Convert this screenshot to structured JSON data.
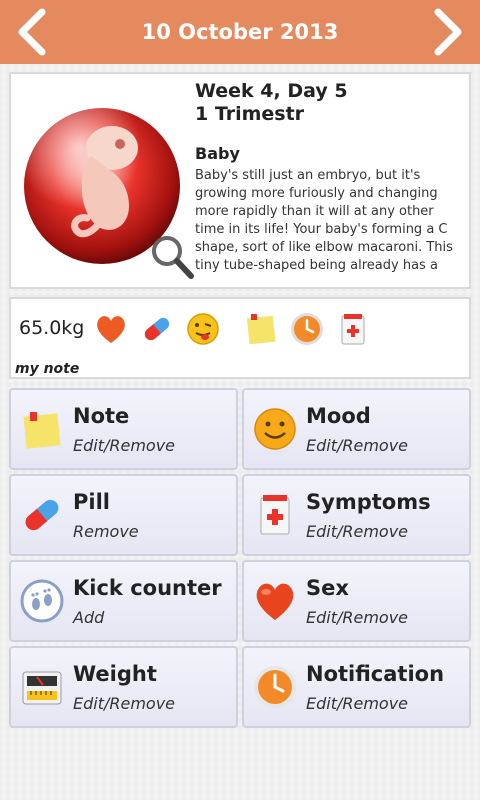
{
  "header": {
    "title": "10 October 2013"
  },
  "info": {
    "week": "Week 4, Day 5",
    "trimester": "1 Trimestr",
    "section_title": "Baby",
    "description": "Baby's still just an embryo, but it's growing more furiously and changing more rapidly than it will at any other time in its life! Your baby's forming a C shape, sort of like elbow macaroni. This tiny tube-shaped being already has a"
  },
  "summary": {
    "weight": "65.0kg",
    "note_label": "my note",
    "icons": [
      "heart-icon",
      "pill-icon",
      "mood-tongue-icon",
      "note-icon",
      "clock-icon",
      "symptoms-icon"
    ]
  },
  "tiles": [
    {
      "label": "Note",
      "sub": "Edit/Remove",
      "icon": "note-icon"
    },
    {
      "label": "Mood",
      "sub": "Edit/Remove",
      "icon": "smiley-icon"
    },
    {
      "label": "Pill",
      "sub": "Remove",
      "icon": "pill-icon"
    },
    {
      "label": "Symptoms",
      "sub": "Edit/Remove",
      "icon": "symptoms-icon"
    },
    {
      "label": "Kick counter",
      "sub": "Add",
      "icon": "footprints-icon"
    },
    {
      "label": "Sex",
      "sub": "Edit/Remove",
      "icon": "heart-icon"
    },
    {
      "label": "Weight",
      "sub": "Edit/Remove",
      "icon": "scale-icon"
    },
    {
      "label": "Notification",
      "sub": "Edit/Remove",
      "icon": "clock-icon"
    }
  ],
  "colors": {
    "header": "#e58a5f",
    "tile_border": "#cfd0df",
    "accent_red": "#e8322a"
  }
}
